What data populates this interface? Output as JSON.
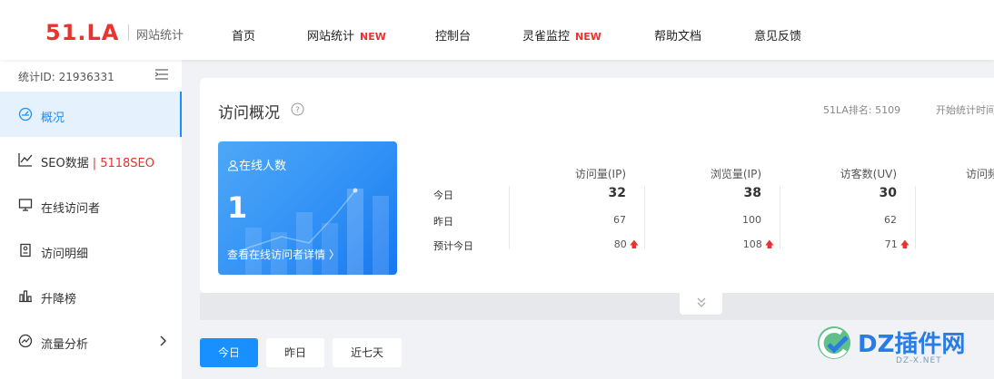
{
  "nav": {
    "logo": "51.LA",
    "logo_sub": "网站统计",
    "items": [
      {
        "label": "首页",
        "badge": ""
      },
      {
        "label": "网站统计",
        "badge": "NEW"
      },
      {
        "label": "控制台",
        "badge": ""
      },
      {
        "label": "灵雀监控",
        "badge": "NEW"
      },
      {
        "label": "帮助文档",
        "badge": ""
      },
      {
        "label": "意见反馈",
        "badge": ""
      }
    ]
  },
  "sidebar": {
    "stat_id": "统计ID: 21936331",
    "items": [
      {
        "label": "概况",
        "icon": "dashboard-icon",
        "active": true
      },
      {
        "label": "SEO数据",
        "extra": "| 5118SEO",
        "icon": "line-chart-icon"
      },
      {
        "label": "在线访问者",
        "icon": "monitor-icon"
      },
      {
        "label": "访问明细",
        "icon": "detail-icon"
      },
      {
        "label": "升降榜",
        "icon": "bar-chart-icon"
      },
      {
        "label": "流量分析",
        "icon": "traffic-icon",
        "expandable": true
      }
    ]
  },
  "overview": {
    "title": "访问概况",
    "rank": "51LA排名: 5109",
    "start": "开始统计时间",
    "online": {
      "title": "在线人数",
      "count": "1",
      "link": "查看在线访问者详情 〉"
    },
    "rows": [
      "今日",
      "昨日",
      "预计今日"
    ],
    "columns": [
      {
        "head": "访问量(IP)",
        "today": "32",
        "yesterday": "67",
        "predicted": "80"
      },
      {
        "head": "浏览量(IP)",
        "today": "38",
        "yesterday": "100",
        "predicted": "108"
      },
      {
        "head": "访客数(UV)",
        "today": "30",
        "yesterday": "62",
        "predicted": "71"
      },
      {
        "head": "访问频"
      }
    ]
  },
  "filters": {
    "today": "今日",
    "yesterday": "昨日",
    "week": "近七天"
  },
  "watermark": {
    "text": "DZ插件网",
    "sub": "DZ-X.NET"
  },
  "colors": {
    "brand": "#e8332f",
    "accent": "#1890ff"
  }
}
